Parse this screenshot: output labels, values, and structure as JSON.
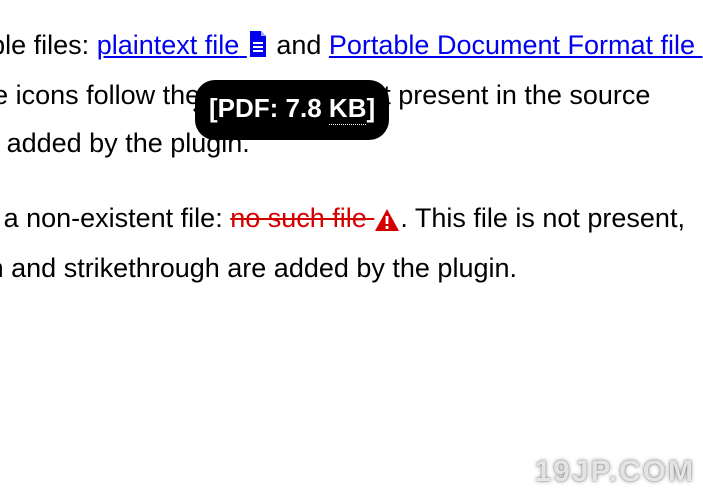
{
  "para1": {
    "t1": "two downloadable files: ",
    "link1": "plaintext file",
    "t2": " and ",
    "link2": "Portable Document Format file",
    "t3": ". Note that some icons follow them which are not present in the source markup, but are added by the plugin."
  },
  "tooltip": {
    "open": "[",
    "label": "PDF: 7.8 ",
    "kb": "KB",
    "close": "]"
  },
  "para2": {
    "t1": "Here is a link to a non-existent file: ",
    "broken": "no such file",
    "t2": ". This file is not present, and the red icon and strikethrough are added by the plugin."
  },
  "watermark": "19JP.COM"
}
